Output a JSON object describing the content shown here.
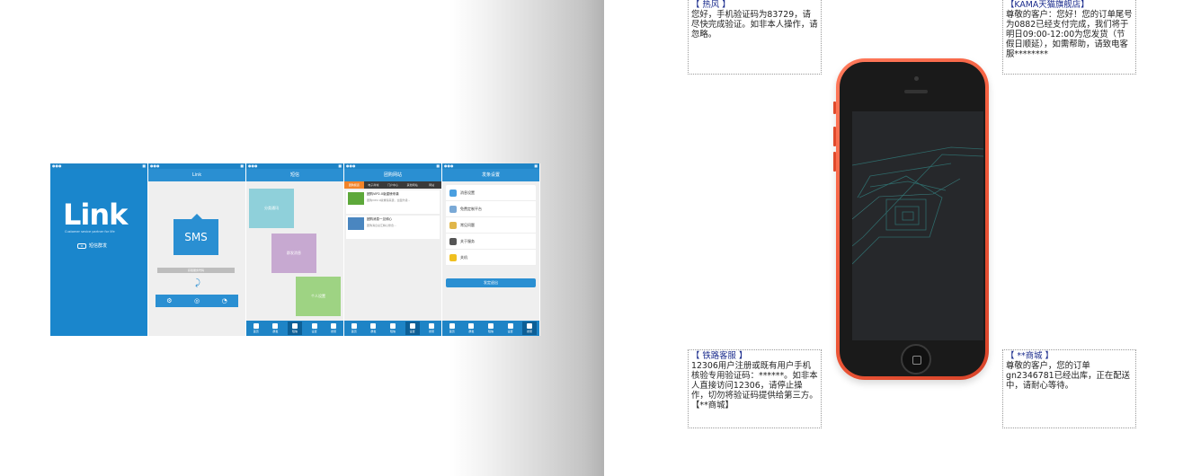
{
  "strip": {
    "splash": {
      "logo": "Link",
      "tagline": "Customer sevice partner for life",
      "badge": "短信群发"
    },
    "screen2": {
      "title": "Link",
      "sms_label": "SMS",
      "bar_label": "获取服务号码"
    },
    "screen3": {
      "title": "短信",
      "cards": [
        "分类通讯",
        "群发消息",
        "个人设置"
      ]
    },
    "screen4": {
      "title": "团购网站",
      "subtabs": [
        "团购频道",
        "电子商城",
        "门户中心",
        "其他网站",
        "网站"
      ],
      "news": [
        {
          "title": "团购VIP2.0版重磅来袭",
          "desc": "团购VIP2.0版重磅来袭，全面升级..."
        },
        {
          "title": "团购消息一见倾心",
          "desc": "团购消息总汇精心整合..."
        }
      ]
    },
    "screen5": {
      "title": "发条设置",
      "rows": [
        "消息设置",
        "免费定制平台",
        "常见问题",
        "关于服务",
        "关机"
      ],
      "button": "发定退出"
    },
    "tab_labels": [
      "首页",
      "群发",
      "短信",
      "设置",
      "搜索"
    ]
  },
  "notes": {
    "top_left": {
      "head": "【 热风 】",
      "body": "您好，手机验证码为83729，请尽快完成验证。如非本人操作，请忽略。"
    },
    "top_right": {
      "head": "【KAMA天猫旗舰店】",
      "body": "尊敬的客户：您好！您的订单尾号为0882已经支付完成，我们将于明日09:00-12:00为您发货（节假日顺延），如需帮助，请致电客服********"
    },
    "bottom_left": {
      "head": "【 铁路客服 】",
      "body": "12306用户注册或既有用户手机核验专用验证码：******。如非本人直接访问12306，请停止操作，切勿将验证码提供给第三方。",
      "tail": "【**商城】"
    },
    "bottom_right": {
      "head": "【 **商城 】",
      "body": "尊敬的客户，您的订单gn2346781已经出库，正在配送中，请耐心等待。"
    }
  }
}
